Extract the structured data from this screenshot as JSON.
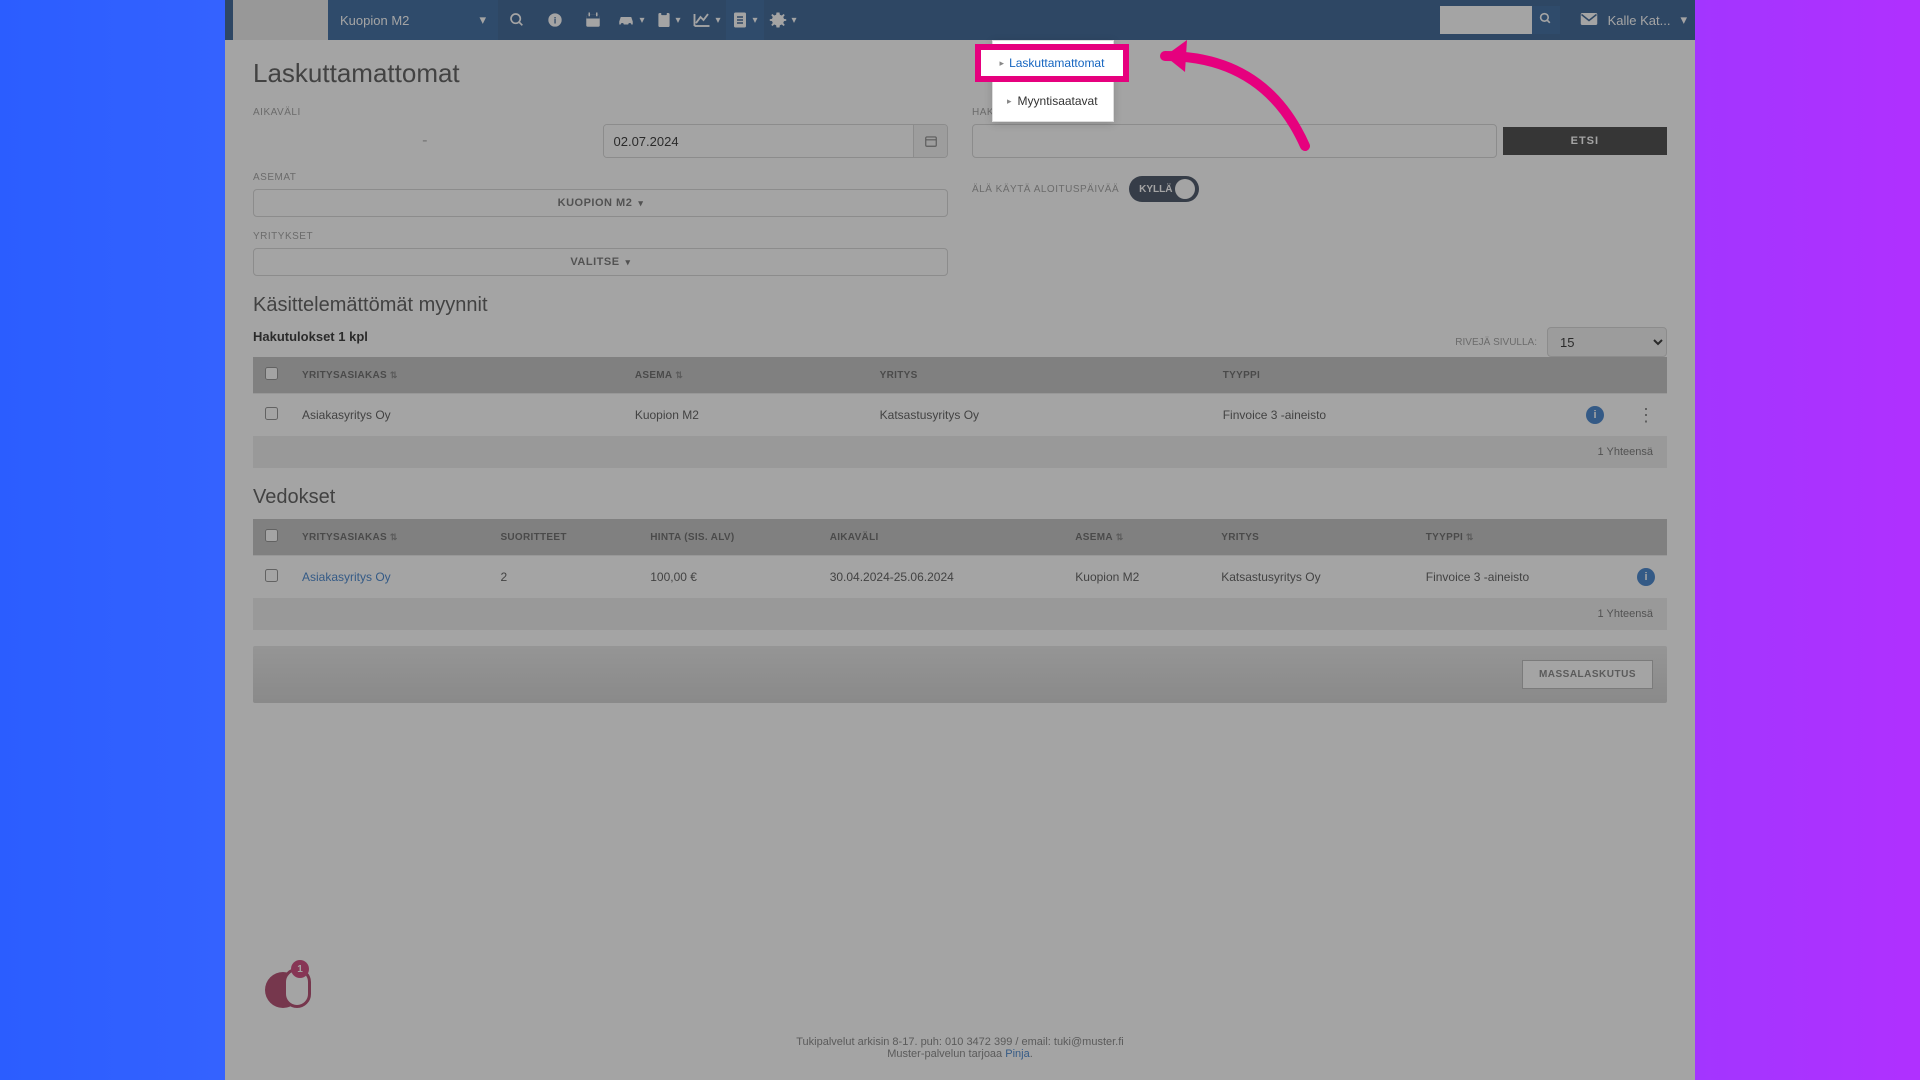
{
  "topbar": {
    "station": "Kuopion M2",
    "user": "Kalle Kat..."
  },
  "dropdown": {
    "item1": "Laskuttamattomat",
    "item2": "Myyntisaatavat"
  },
  "page": {
    "title": "Laskuttamattomat"
  },
  "filters": {
    "aikavali_label": "AIKAVÄLI",
    "date_to": "02.07.2024",
    "hakusana_label": "HAKUSANA",
    "etsi": "ETSI",
    "asemat_label": "ASEMAT",
    "asemat_value": "KUOPION M2",
    "toggle_label": "ÄLÄ KÄYTÄ ALOITUSPÄIVÄÄ",
    "toggle_value": "KYLLÄ",
    "yritykset_label": "YRITYKSET",
    "yritykset_value": "VALITSE"
  },
  "section1": {
    "title": "Käsittelemättömät myynnit",
    "results": "Hakutulokset 1 kpl",
    "perpage_label": "RIVEJÄ SIVULLA:",
    "perpage_value": "15",
    "headers": {
      "yritysasiakas": "YRITYSASIAKAS",
      "asema": "ASEMA",
      "yritys": "YRITYS",
      "tyyppi": "TYYPPI"
    },
    "rows": [
      {
        "yritysasiakas": "Asiakasyritys Oy",
        "asema": "Kuopion M2",
        "yritys": "Katsastusyritys Oy",
        "tyyppi": "Finvoice 3 -aineisto"
      }
    ],
    "footer": "1 Yhteensä"
  },
  "section2": {
    "title": "Vedokset",
    "headers": {
      "yritysasiakas": "YRITYSASIAKAS",
      "suoritteet": "SUORITTEET",
      "hinta": "HINTA (SIS. ALV)",
      "aikavali": "AIKAVÄLI",
      "asema": "ASEMA",
      "yritys": "YRITYS",
      "tyyppi": "TYYPPI"
    },
    "rows": [
      {
        "yritysasiakas": "Asiakasyritys Oy",
        "suoritteet": "2",
        "hinta": "100,00 €",
        "aikavali": "30.04.2024-25.06.2024",
        "asema": "Kuopion M2",
        "yritys": "Katsastusyritys Oy",
        "tyyppi": "Finvoice 3 -aineisto"
      }
    ],
    "footer": "1 Yhteensä"
  },
  "massbtn": "MASSALASKUTUS",
  "footer": {
    "line1": "Tukipalvelut arkisin 8-17. puh: 010 3472 399 / email: tuki@muster.fi",
    "line2a": "Muster-palvelun tarjoaa ",
    "line2b": "Pinja",
    "line2c": "."
  },
  "badge": "1"
}
